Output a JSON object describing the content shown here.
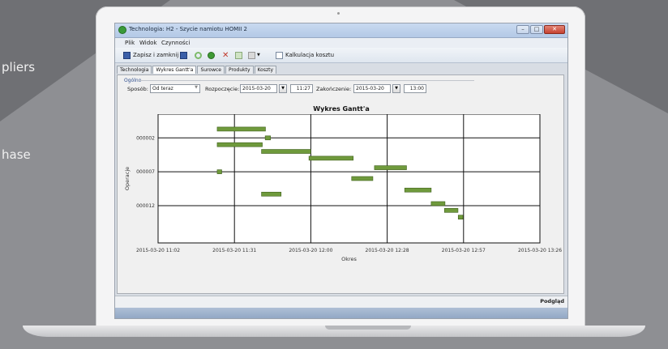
{
  "background": {
    "text_lines": [
      "pliers",
      "hase"
    ]
  },
  "window": {
    "title": "Technologia: H2 - Szycie namiotu HOMII 2",
    "min_label": "–",
    "max_label": "□",
    "close_label": "✕"
  },
  "menu": {
    "items": [
      "Plik",
      "Widok",
      "Czynności"
    ]
  },
  "toolbar": {
    "save_close_label": "Zapisz i zamknij",
    "cost_calc_label": "Kalkulacja kosztu"
  },
  "tabs": [
    {
      "label": "Technologia",
      "active": false
    },
    {
      "label": "Wykres Gantt'a",
      "active": true
    },
    {
      "label": "Surowce",
      "active": false
    },
    {
      "label": "Produkty",
      "active": false
    },
    {
      "label": "Koszty",
      "active": false
    }
  ],
  "filters": {
    "group_label": "Ogólne",
    "mode_label": "Sposób:",
    "mode_value": "Od teraz",
    "start_label": "Rozpoczęcie:",
    "start_date": "2015-03-20",
    "start_time": "11:27",
    "end_label": "Zakończenie:",
    "end_date": "2015-03-20",
    "end_time": "13:00"
  },
  "status": {
    "preview_label": "Podgląd"
  },
  "colors": {
    "bar": "#6f9a3c",
    "bar_border": "#3f5f1c",
    "plot_bg": "#ffffff",
    "grid": "#111111"
  },
  "chart_data": {
    "type": "gantt",
    "title": "Wykres Gantt'a",
    "xlabel": "Okres",
    "ylabel": "Operacje",
    "x_ticks": [
      "2015-03-20 11:02",
      "2015-03-20 11:31",
      "2015-03-20 12:00",
      "2015-03-20 12:28",
      "2015-03-20 12:57",
      "2015-03-20 13:26"
    ],
    "x_range_minutes": [
      0,
      144
    ],
    "y_ticks": [
      "000002",
      "000007",
      "000012"
    ],
    "y_tick_rows": [
      2,
      7,
      12
    ],
    "y_range_rows": [
      -1.5,
      17.5
    ],
    "tasks": [
      {
        "row": 0.7,
        "start_min": 22.3,
        "end_min": 40.5
      },
      {
        "row": 2.0,
        "start_min": 40.4,
        "end_min": 42.4
      },
      {
        "row": 3.0,
        "start_min": 22.3,
        "end_min": 39.3
      },
      {
        "row": 4.0,
        "start_min": 39.0,
        "end_min": 57.6
      },
      {
        "row": 5.0,
        "start_min": 56.9,
        "end_min": 73.6
      },
      {
        "row": 7.0,
        "start_min": 22.3,
        "end_min": 24.0
      },
      {
        "row": 6.4,
        "start_min": 81.6,
        "end_min": 93.7
      },
      {
        "row": 8.0,
        "start_min": 73.0,
        "end_min": 81.0
      },
      {
        "row": 9.7,
        "start_min": 93.0,
        "end_min": 103.0
      },
      {
        "row": 10.3,
        "start_min": 39.0,
        "end_min": 46.4
      },
      {
        "row": 11.7,
        "start_min": 103.0,
        "end_min": 108.2
      },
      {
        "row": 12.7,
        "start_min": 108.0,
        "end_min": 113.1
      },
      {
        "row": 13.7,
        "start_min": 113.2,
        "end_min": 115.0
      }
    ]
  }
}
